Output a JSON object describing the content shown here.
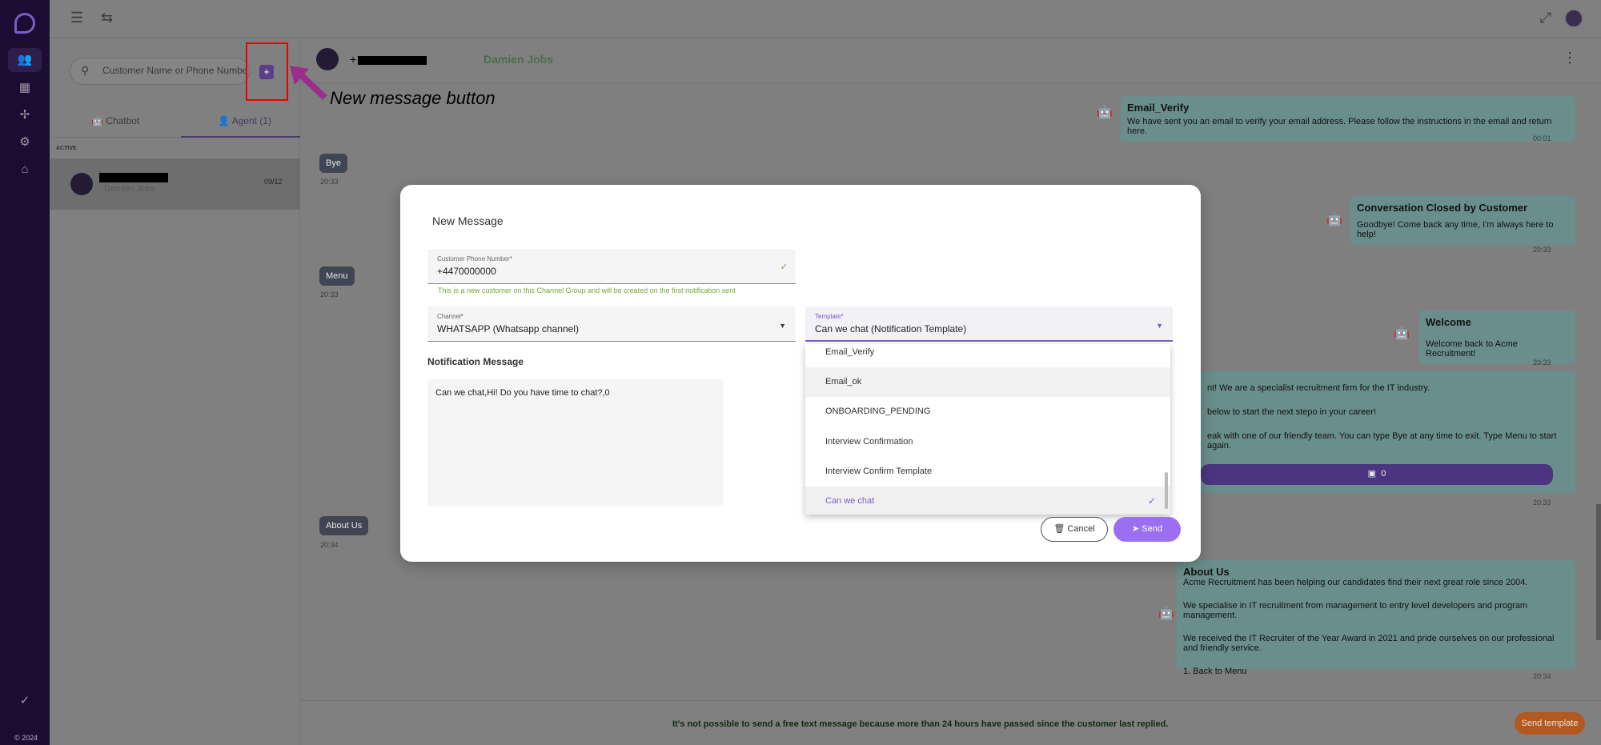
{
  "app": {
    "copyright": "© 2024",
    "colors": {
      "brand_purple": "#7b5cc7",
      "sidebar": "#1c0b33",
      "send_button": "#9c6ff0",
      "send_template": "#b3581e"
    }
  },
  "sidebar": {
    "icons": [
      "chat-logo-icon",
      "users-icon",
      "store-icon",
      "network-icon",
      "settings-icon",
      "home-icon",
      "check-circle-icon"
    ]
  },
  "leftpanel": {
    "search_placeholder": "Customer Name or Phone Number",
    "tabs": [
      {
        "label": "Chatbot"
      },
      {
        "label": "Agent (1)"
      }
    ],
    "section_label": "ACTIVE",
    "conversation": {
      "name": "Damien Jobs",
      "date": "09/12"
    }
  },
  "annotation": {
    "text": "New message button"
  },
  "chat": {
    "header": {
      "prefix": "+",
      "name": "Damien Jobs"
    },
    "incoming": [
      {
        "text": "Bye",
        "time": "20:33"
      },
      {
        "text": "Menu",
        "time": "20:33"
      },
      {
        "text": "About Us",
        "time": "20:34"
      }
    ],
    "outgoing": {
      "email_verify": {
        "title": "Email_Verify",
        "body": "We have sent you an email to verify your email address. Please follow the instructions in the email and return here.",
        "time": "00:01"
      },
      "closed": {
        "title": "Conversation Closed by Customer",
        "body": "Goodbye! Come back any time, I'm always here to help!",
        "time": "20:33"
      },
      "welcome": {
        "title": "Welcome",
        "body": "Welcome back to Acme Recruitment!",
        "time": "20:33"
      },
      "menu_lines": [
        "nt! We are a specialist recruitment firm for the IT industry.",
        "below to start the next stepo in your career!",
        "eak with one of our friendly team. You can type Bye at any time to exit. Type Menu to start again."
      ],
      "menu_button": "0",
      "menu_time": "20:33",
      "about": {
        "title": "About Us",
        "lines": [
          "Acme Recruitment has been helping our candidates find their next great role since 2004.",
          "We specialise in IT recruitment from management to entry level developers and program management.",
          "We received the IT Recruiter of the Year Award in 2021 and pride ourselves on our professional and friendly service.",
          "1.   Back to Menu"
        ],
        "time": "20:34"
      }
    },
    "footer_notice": "It's not possible to send a free text message because more than 24 hours have passed since the customer last replied.",
    "send_template_label": "Send template"
  },
  "modal": {
    "title": "New Message",
    "phone": {
      "label": "Customer Phone Number*",
      "value": "+4470000000"
    },
    "hint": "This is a new customer on this Channel Group and will be created on the first notification sent",
    "channel": {
      "label": "Channel*",
      "value": "WHATSAPP (Whatsapp channel)"
    },
    "template": {
      "label": "Template*",
      "value": "Can we chat (Notification Template)"
    },
    "notification_title": "Notification Message",
    "notification_body": "Can we chat,Hi! Do you have time to chat?,0",
    "options": [
      "Email_Verify",
      "Email_ok",
      "ONBOARDING_PENDING",
      "Interview Confirmation",
      "Interview Confirm Template",
      "Can we chat"
    ],
    "selected_option": "Can we chat",
    "cancel_label": "Cancel",
    "send_label": "Send"
  }
}
